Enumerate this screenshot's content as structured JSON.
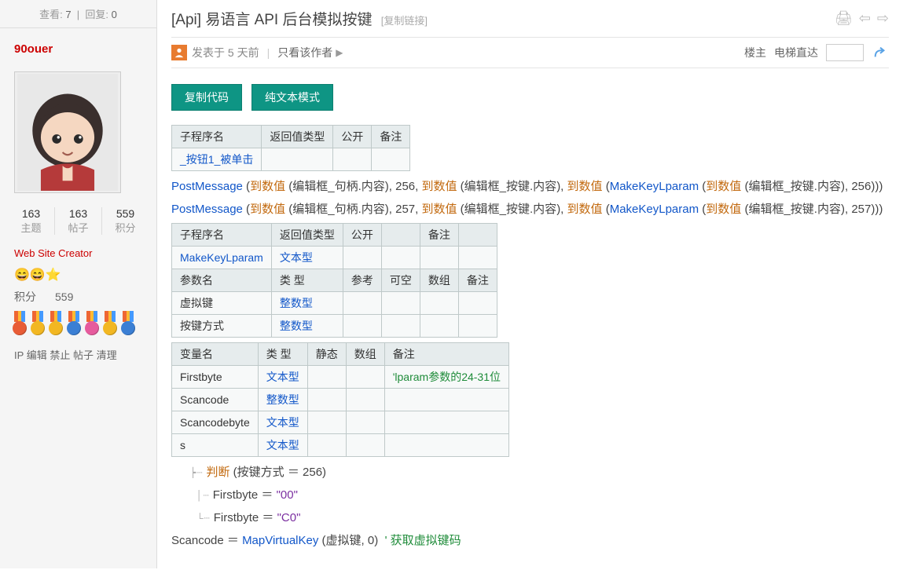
{
  "sidebar": {
    "views_label": "查看:",
    "views": "7",
    "replies_label": "回复:",
    "replies": "0",
    "username": "90ouer",
    "counts": [
      {
        "num": "163",
        "lab": "主题"
      },
      {
        "num": "163",
        "lab": "帖子"
      },
      {
        "num": "559",
        "lab": "积分"
      }
    ],
    "role": "Web Site Creator",
    "emoji": "😄😄⭐",
    "score_label": "积分",
    "score_value": "559",
    "medal_colors": [
      "#e85c36",
      "#f2b722",
      "#f2b722",
      "#3b7fd4",
      "#e65b9d",
      "#f2b722",
      "#3b7fd4"
    ],
    "mod_links": [
      "IP",
      "编辑",
      "禁止",
      "帖子",
      "清理"
    ]
  },
  "header": {
    "prefix": "[Api]",
    "title": "易语言 API 后台模拟按键",
    "copy": "[复制链接]"
  },
  "meta": {
    "posted": "发表于 5 天前",
    "only_author": "只看该作者",
    "owner": "楼主",
    "elevator": "电梯直达"
  },
  "buttons": {
    "copycode": "复制代码",
    "plain": "纯文本模式"
  },
  "table1": {
    "head": [
      "子程序名",
      "返回值类型",
      "公开",
      "备注"
    ],
    "row1": "_按钮1_被单击"
  },
  "line1": {
    "fn": "PostMessage",
    "todv": "到数值",
    "a": "编辑框_句柄.内容",
    "n": "256",
    "b": "编辑框_按键.内容",
    "mk": "MakeKeyLparam",
    "c": "编辑框_按键.内容",
    "d": "256"
  },
  "line2": {
    "fn": "PostMessage",
    "todv": "到数值",
    "a": "编辑框_句柄.内容",
    "n": "257",
    "b": "编辑框_按键.内容",
    "mk": "MakeKeyLparam",
    "c": "编辑框_按键.内容",
    "d": "257"
  },
  "table2": {
    "r0": [
      "子程序名",
      "返回值类型",
      "公开",
      "",
      "备注"
    ],
    "r1a": "MakeKeyLparam",
    "r1b": "文本型",
    "r2": [
      "参数名",
      "类 型",
      "参考",
      "可空",
      "数组",
      "备注"
    ],
    "r3a": "虚拟键",
    "r3b": "整数型",
    "r4a": "按键方式",
    "r4b": "整数型"
  },
  "table3": {
    "head": [
      "变量名",
      "类 型",
      "静态",
      "数组",
      "备注"
    ],
    "rows": [
      {
        "name": "Firstbyte",
        "type": "文本型",
        "note": "'lparam参数的24-31位"
      },
      {
        "name": "Scancode",
        "type": "整数型",
        "note": ""
      },
      {
        "name": "Scancodebyte",
        "type": "文本型",
        "note": ""
      },
      {
        "name": "s",
        "type": "文本型",
        "note": ""
      }
    ]
  },
  "logic": {
    "judge": "判断",
    "cond_l": "按键方式",
    "eq": "＝",
    "cond_r": "256",
    "fb": "Firstbyte",
    "v1": "\"00\"",
    "v2": "\"C0\"",
    "sc": "Scancode",
    "mvk": "MapVirtualKey",
    "arg1": "虚拟键",
    "arg2": "0",
    "comment": "' 获取虚拟键码"
  }
}
